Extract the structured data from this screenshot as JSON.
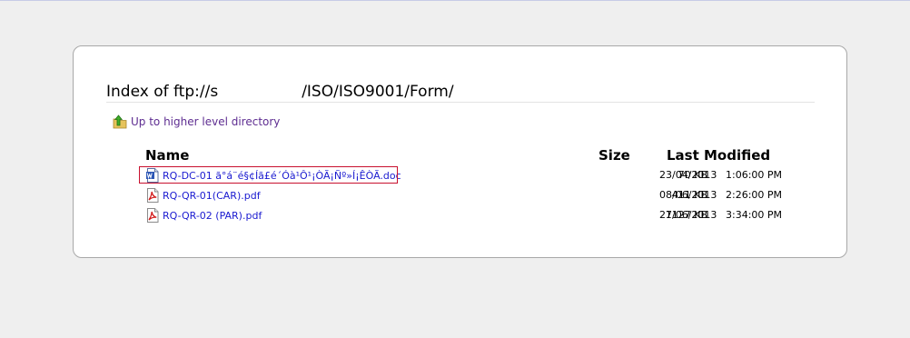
{
  "index": {
    "prefix": "Index of ftp://",
    "host_visible": "s",
    "path": "/ISO/ISO9001/Form/"
  },
  "up_link": {
    "label": "Up to higher level directory",
    "icon": "up-folder-icon"
  },
  "columns": {
    "name": "Name",
    "size": "Size",
    "modified": "Last Modified"
  },
  "files": [
    {
      "name": "RQ-DC-01 ã°á¨é§¢Íã£é´Óà¹Ô¹¡ÒÃ¡Ñº»Í¡ÊÒÃ.doc",
      "size": "70 KB",
      "date": "23/04/2013",
      "time": "1:06:00 PM",
      "icon": "word-doc-icon",
      "highlighted": true
    },
    {
      "name": "RQ-QR-01(CAR).pdf",
      "size": "411 KB",
      "date": "08/06/2013",
      "time": "2:26:00 PM",
      "icon": "pdf-icon",
      "highlighted": false
    },
    {
      "name": "RQ-QR-02 (PAR).pdf",
      "size": "1127 KB",
      "date": "27/06/2013",
      "time": "3:34:00 PM",
      "icon": "pdf-icon",
      "highlighted": false
    }
  ],
  "colors": {
    "page_background": "#efefef",
    "panel_background": "#ffffff",
    "visited_link": "#5e2d91",
    "file_link": "#1a1ad0",
    "highlight_border": "#c8102e"
  }
}
